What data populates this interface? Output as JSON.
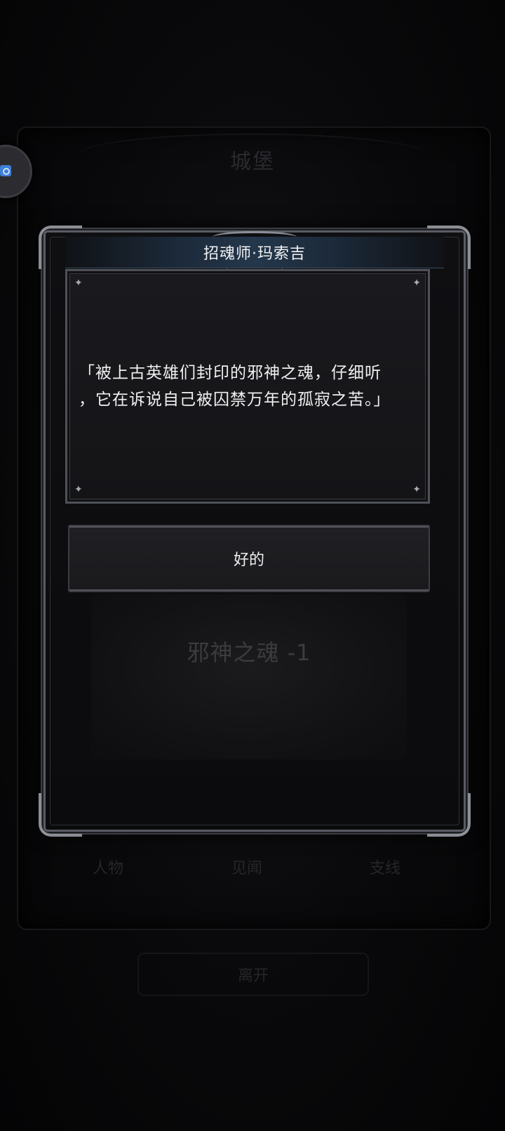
{
  "background": {
    "title": "城堡",
    "tabs": [
      "人物",
      "见闻",
      "支线"
    ],
    "leave_label": "离开"
  },
  "dialog": {
    "npc_name": "招魂师·玛索吉",
    "text": "「被上古英雄们封印的邪神之魂，仔细听\n，它在诉说自己被囚禁万年的孤寂之苦。」",
    "option_label": "好的",
    "item_label": "邪神之魂 -1"
  },
  "icons": {
    "sparkle": "✦",
    "assistant": "floating-assistant-icon"
  },
  "colors": {
    "title_bar_accent": "#24374b",
    "frame_silver": "#9a9ca4",
    "assistant_blue": "#3e7fd9"
  }
}
